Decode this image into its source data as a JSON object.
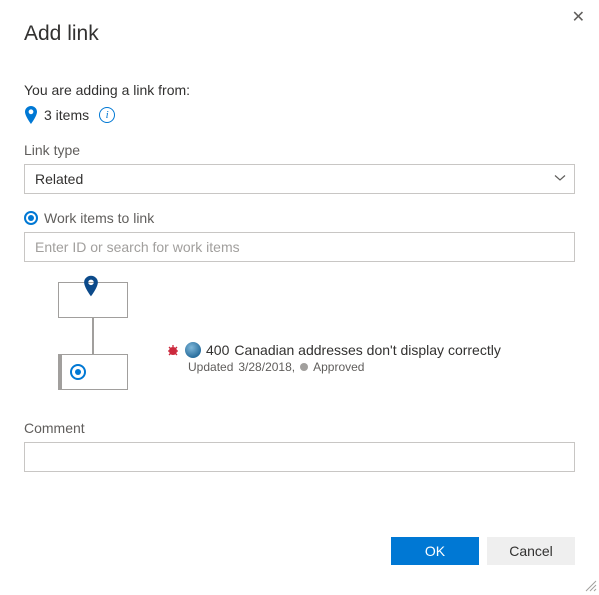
{
  "dialog": {
    "title": "Add link",
    "close_icon": "✕"
  },
  "intro": {
    "text": "You are adding a link from:",
    "count_text": "3 items"
  },
  "link_type": {
    "label": "Link type",
    "selected": "Related"
  },
  "work_items": {
    "label": "Work items to link",
    "placeholder": "Enter ID or search for work items"
  },
  "linked_item": {
    "id": "400",
    "title": "Canadian addresses don't display correctly",
    "updated_prefix": "Updated",
    "updated": "3/28/2018,",
    "state": "Approved"
  },
  "comment": {
    "label": "Comment",
    "value": ""
  },
  "buttons": {
    "ok": "OK",
    "cancel": "Cancel"
  }
}
